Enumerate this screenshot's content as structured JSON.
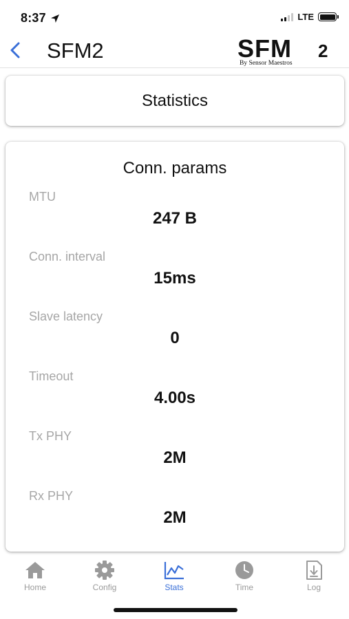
{
  "status_bar": {
    "time": "8:37",
    "network": "LTE"
  },
  "nav": {
    "title": "SFM2",
    "logo": {
      "main": "SFM",
      "sub": "2",
      "tagline": "By Sensor Maestros"
    }
  },
  "stats_card": {
    "title": "Statistics"
  },
  "conn_params": {
    "title": "Conn. params",
    "items": [
      {
        "label": "MTU",
        "value": "247 B"
      },
      {
        "label": "Conn. interval",
        "value": "15ms"
      },
      {
        "label": "Slave latency",
        "value": "0"
      },
      {
        "label": "Timeout",
        "value": "4.00s"
      },
      {
        "label": "Tx PHY",
        "value": "2M"
      },
      {
        "label": "Rx PHY",
        "value": "2M"
      }
    ]
  },
  "tabs": [
    {
      "label": "Home",
      "icon": "house-icon",
      "active": false
    },
    {
      "label": "Config",
      "icon": "gear-icon",
      "active": false
    },
    {
      "label": "Stats",
      "icon": "line-chart-icon",
      "active": true
    },
    {
      "label": "Time",
      "icon": "clock-icon",
      "active": false
    },
    {
      "label": "Log",
      "icon": "download-file-icon",
      "active": false
    }
  ],
  "colors": {
    "accent": "#3a6fd8",
    "inactive_tab": "#9a9a9a",
    "label_gray": "#a6a6a6"
  }
}
